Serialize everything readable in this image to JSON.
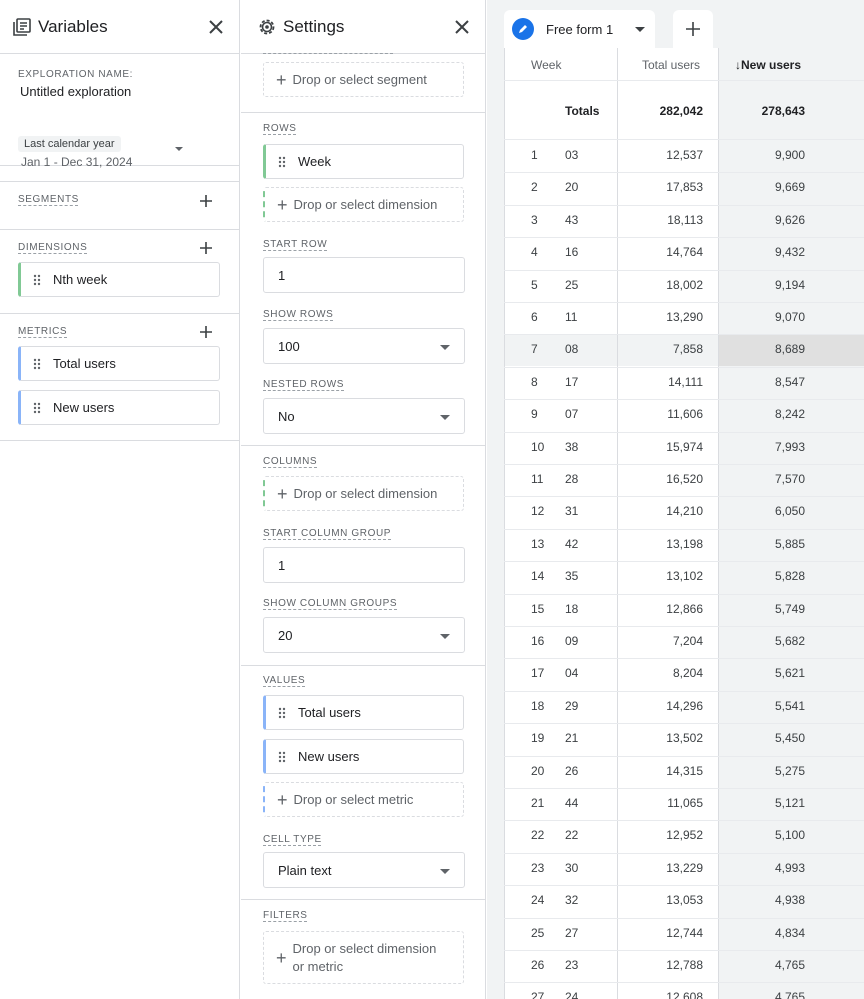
{
  "variables": {
    "title": "Variables",
    "exploration_caption": "EXPLORATION NAME:",
    "exploration_name": "Untitled exploration",
    "date_chip": "Last calendar year",
    "date_range": "Jan 1 - Dec 31, 2024",
    "segments_caption": "SEGMENTS",
    "dimensions_caption": "DIMENSIONS",
    "dimensions": [
      "Nth week"
    ],
    "metrics_caption": "METRICS",
    "metrics": [
      "Total users",
      "New users"
    ]
  },
  "settings": {
    "title": "Settings",
    "segment_drop": "Drop or select segment",
    "rows_caption": "ROWS",
    "rows_chip": "Week",
    "rows_drop": "Drop or select dimension",
    "start_row_caption": "START ROW",
    "start_row": "1",
    "show_rows_caption": "SHOW ROWS",
    "show_rows": "100",
    "nested_rows_caption": "NESTED ROWS",
    "nested_rows": "No",
    "columns_caption": "COLUMNS",
    "columns_drop": "Drop or select dimension",
    "start_col_caption": "START COLUMN GROUP",
    "start_col": "1",
    "show_col_caption": "SHOW COLUMN GROUPS",
    "show_col": "20",
    "values_caption": "VALUES",
    "values": [
      "Total users",
      "New users"
    ],
    "values_drop": "Drop or select metric",
    "cell_type_caption": "CELL TYPE",
    "cell_type": "Plain text",
    "filters_caption": "FILTERS",
    "filters_drop_line1": "Drop or select dimension",
    "filters_drop_line2": "or metric"
  },
  "canvas": {
    "tab_label": "Free form 1",
    "headers": {
      "week": "Week",
      "total_users": "Total users",
      "new_users": "New users",
      "sort_arrow": "↓"
    },
    "totals": {
      "label": "Totals",
      "total_users": "282,042",
      "new_users": "278,643"
    },
    "rows": [
      {
        "n": "1",
        "week": "03",
        "total_users": "12,537",
        "new_users": "9,900"
      },
      {
        "n": "2",
        "week": "20",
        "total_users": "17,853",
        "new_users": "9,669"
      },
      {
        "n": "3",
        "week": "43",
        "total_users": "18,113",
        "new_users": "9,626"
      },
      {
        "n": "4",
        "week": "16",
        "total_users": "14,764",
        "new_users": "9,432"
      },
      {
        "n": "5",
        "week": "25",
        "total_users": "18,002",
        "new_users": "9,194"
      },
      {
        "n": "6",
        "week": "11",
        "total_users": "13,290",
        "new_users": "9,070"
      },
      {
        "n": "7",
        "week": "08",
        "total_users": "7,858",
        "new_users": "8,689"
      },
      {
        "n": "8",
        "week": "17",
        "total_users": "14,111",
        "new_users": "8,547"
      },
      {
        "n": "9",
        "week": "07",
        "total_users": "11,606",
        "new_users": "8,242"
      },
      {
        "n": "10",
        "week": "38",
        "total_users": "15,974",
        "new_users": "7,993"
      },
      {
        "n": "11",
        "week": "28",
        "total_users": "16,520",
        "new_users": "7,570"
      },
      {
        "n": "12",
        "week": "31",
        "total_users": "14,210",
        "new_users": "6,050"
      },
      {
        "n": "13",
        "week": "42",
        "total_users": "13,198",
        "new_users": "5,885"
      },
      {
        "n": "14",
        "week": "35",
        "total_users": "13,102",
        "new_users": "5,828"
      },
      {
        "n": "15",
        "week": "18",
        "total_users": "12,866",
        "new_users": "5,749"
      },
      {
        "n": "16",
        "week": "09",
        "total_users": "7,204",
        "new_users": "5,682"
      },
      {
        "n": "17",
        "week": "04",
        "total_users": "8,204",
        "new_users": "5,621"
      },
      {
        "n": "18",
        "week": "29",
        "total_users": "14,296",
        "new_users": "5,541"
      },
      {
        "n": "19",
        "week": "21",
        "total_users": "13,502",
        "new_users": "5,450"
      },
      {
        "n": "20",
        "week": "26",
        "total_users": "14,315",
        "new_users": "5,275"
      },
      {
        "n": "21",
        "week": "44",
        "total_users": "11,065",
        "new_users": "5,121"
      },
      {
        "n": "22",
        "week": "22",
        "total_users": "12,952",
        "new_users": "5,100"
      },
      {
        "n": "23",
        "week": "30",
        "total_users": "13,229",
        "new_users": "4,993"
      },
      {
        "n": "24",
        "week": "32",
        "total_users": "13,053",
        "new_users": "4,938"
      },
      {
        "n": "25",
        "week": "27",
        "total_users": "12,744",
        "new_users": "4,834"
      },
      {
        "n": "26",
        "week": "23",
        "total_users": "12,788",
        "new_users": "4,765"
      },
      {
        "n": "27",
        "week": "24",
        "total_users": "12,608",
        "new_users": "4,765"
      }
    ]
  }
}
